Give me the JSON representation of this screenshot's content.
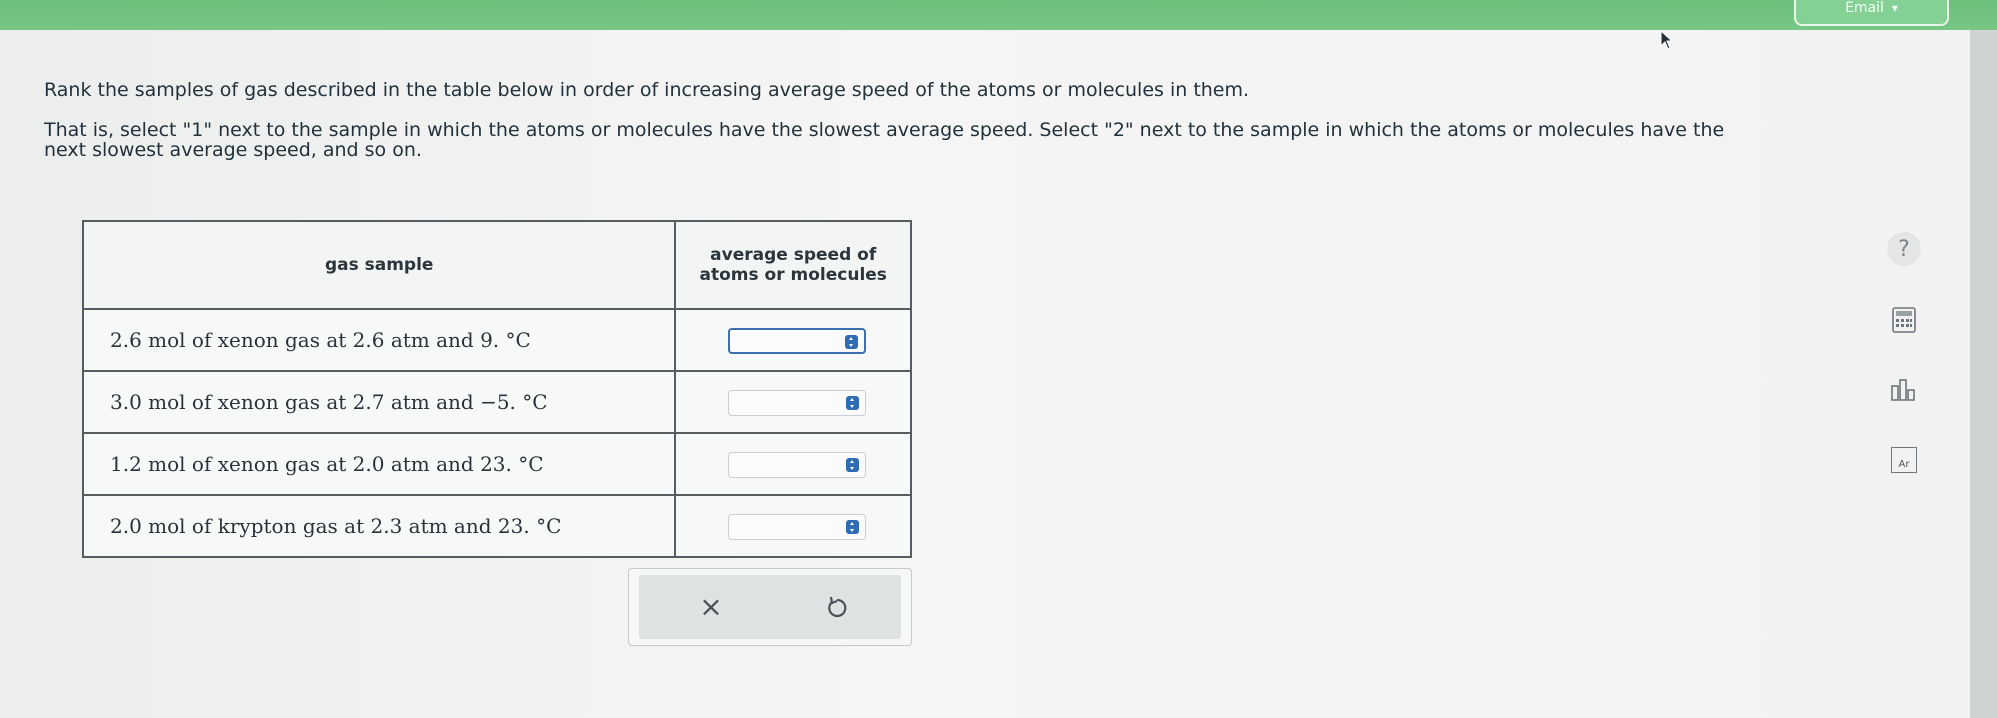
{
  "header": {
    "button_label": "Email"
  },
  "instructions": {
    "line1": "Rank the samples of gas described in the table below in order of increasing average speed of the atoms or molecules in them.",
    "line2": "That is, select \"1\" next to the sample in which the atoms or molecules have the slowest average speed. Select \"2\" next to the sample in which the atoms or molecules have the next slowest average speed, and so on."
  },
  "table": {
    "headers": {
      "gas_sample": "gas sample",
      "speed_line1": "average speed of",
      "speed_line2": "atoms or molecules"
    },
    "rows": [
      {
        "sample": "2.6 mol of xenon gas at 2.6 atm and 9. °C",
        "rank": ""
      },
      {
        "sample": "3.0 mol of xenon gas at 2.7 atm and −5. °C",
        "rank": ""
      },
      {
        "sample": "1.2 mol of xenon gas at 2.0 atm and 23. °C",
        "rank": ""
      },
      {
        "sample": "2.0 mol of krypton gas at 2.3 atm and 23. °C",
        "rank": ""
      }
    ]
  },
  "actions": {
    "clear_symbol": "×"
  },
  "tools": {
    "help_symbol": "?",
    "periodic_table_symbol": "Ar"
  },
  "colors": {
    "header_green": "#6cc07a",
    "accent_blue": "#2f6cb3"
  }
}
